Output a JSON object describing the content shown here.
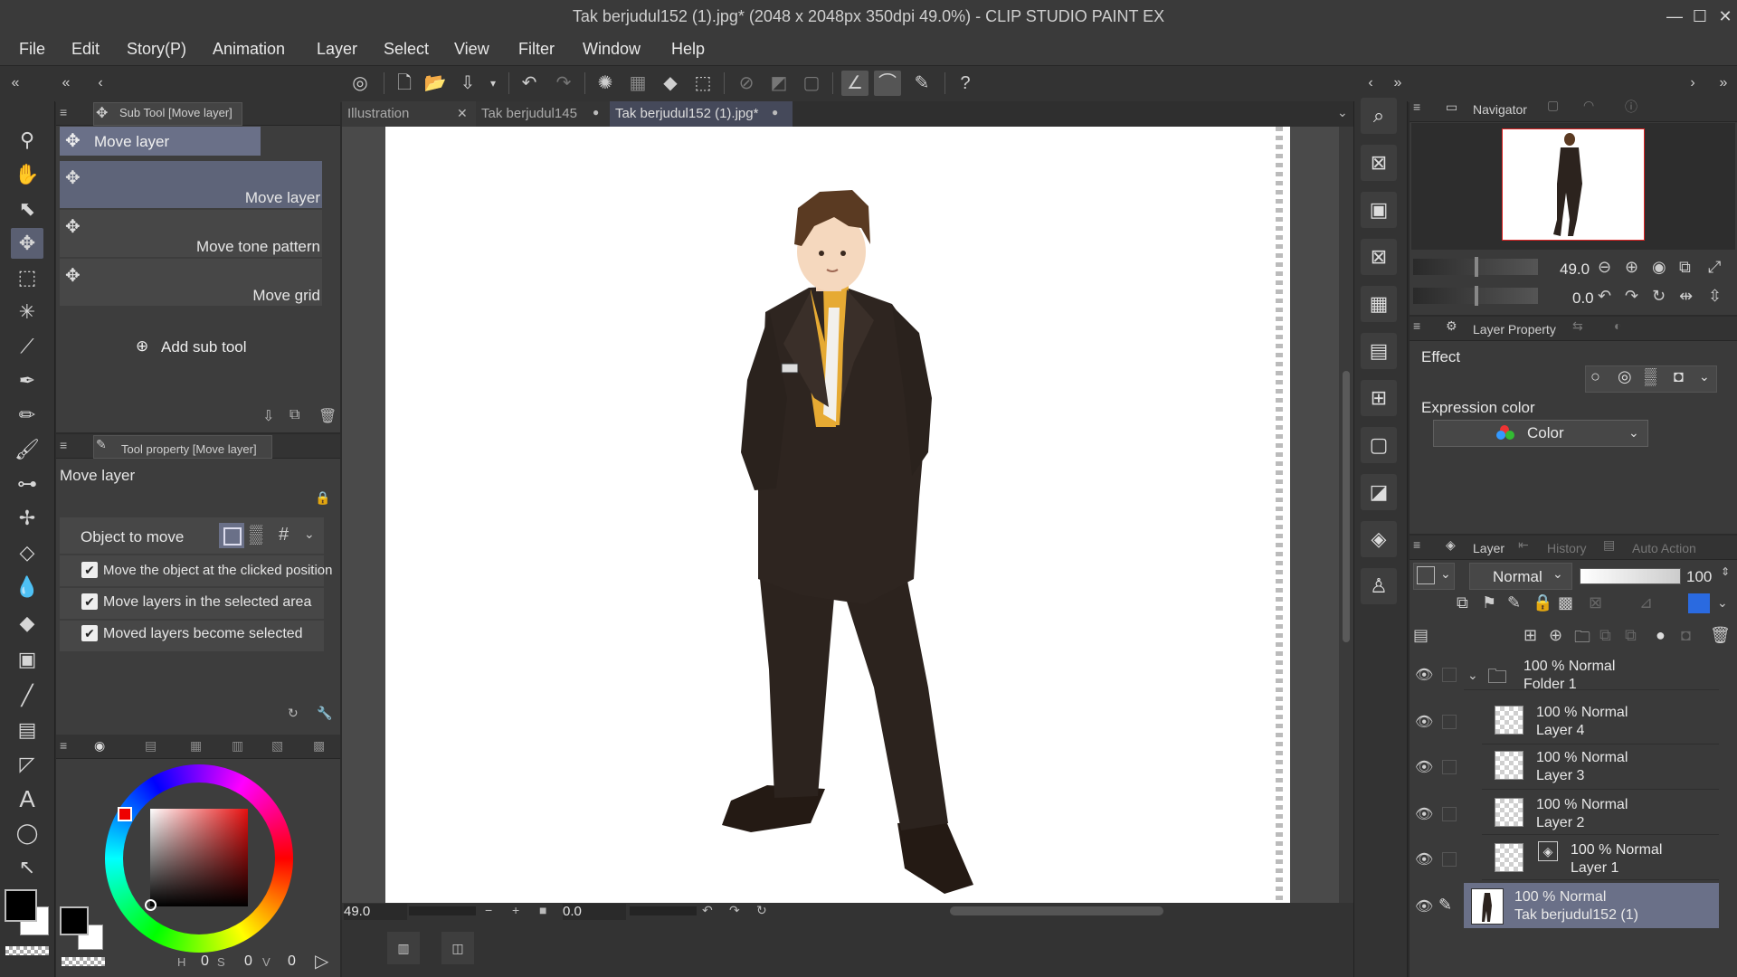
{
  "window": {
    "title": "Tak berjudul152 (1).jpg* (2048 x 2048px 350dpi 49.0%)  - CLIP STUDIO PAINT EX"
  },
  "menu": [
    "File",
    "Edit",
    "Story(P)",
    "Animation",
    "Layer",
    "Select",
    "View",
    "Filter",
    "Window",
    "Help"
  ],
  "subtool": {
    "header": "Sub Tool [Move layer]",
    "group_label": "Move layer",
    "items": [
      "Move layer",
      "Move tone pattern",
      "Move grid"
    ],
    "add_label": "Add sub tool"
  },
  "toolprop": {
    "header": "Tool property [Move layer]",
    "name": "Move layer",
    "object_label": "Object to move",
    "checks": [
      "Move the object at the clicked position",
      "Move layers in the selected area",
      "Moved layers become selected"
    ]
  },
  "color": {
    "main": "#000000",
    "sub": "#ffffff",
    "hsv": {
      "h_label": "H",
      "h": "0",
      "s_label": "S",
      "s": "0",
      "v_label": "V",
      "v": "0"
    }
  },
  "tabs": [
    "Illustration",
    "Tak berjudul145",
    "Tak berjudul152 (1).jpg*"
  ],
  "statusbar": {
    "zoom": "49.0",
    "rotation": "0.0"
  },
  "navigator": {
    "title": "Navigator",
    "zoom": "49.0",
    "angle": "0.0"
  },
  "layerprop": {
    "title": "Layer Property",
    "effect": "Effect",
    "expr_label": "Expression color",
    "expr_value": "Color"
  },
  "layerpanel": {
    "tabs": [
      "Layer",
      "History",
      "Auto Action"
    ],
    "blend": "Normal",
    "opacity": "100",
    "layers": [
      {
        "line1": "100 % Normal",
        "line2": "Folder 1",
        "type": "folder"
      },
      {
        "line1": "100 % Normal",
        "line2": "Layer 4",
        "type": "raster"
      },
      {
        "line1": "100 % Normal",
        "line2": "Layer 3",
        "type": "raster"
      },
      {
        "line1": "100 % Normal",
        "line2": "Layer 2",
        "type": "raster"
      },
      {
        "line1": "100 % Normal",
        "line2": "Layer 1",
        "type": "raster3d"
      },
      {
        "line1": "100 % Normal",
        "line2": "Tak berjudul152 (1)",
        "type": "image",
        "selected": true
      }
    ]
  }
}
